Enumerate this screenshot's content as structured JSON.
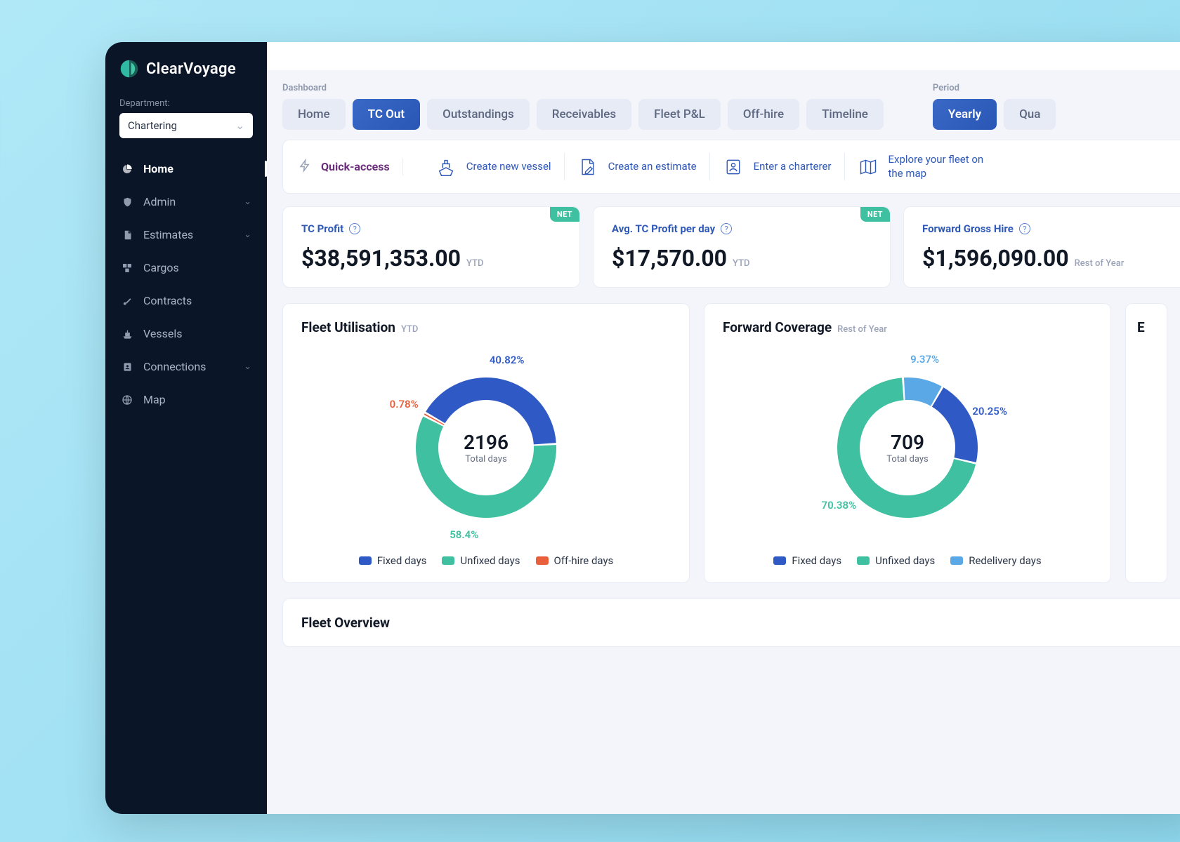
{
  "brand": {
    "name": "ClearVoyage"
  },
  "sidebar": {
    "department_label": "Department:",
    "department_value": "Chartering",
    "items": [
      {
        "label": "Home",
        "icon": "pie-chart-icon",
        "active": true,
        "hasChildren": false
      },
      {
        "label": "Admin",
        "icon": "shield-icon",
        "active": false,
        "hasChildren": true
      },
      {
        "label": "Estimates",
        "icon": "document-icon",
        "active": false,
        "hasChildren": true
      },
      {
        "label": "Cargos",
        "icon": "boxes-icon",
        "active": false,
        "hasChildren": false
      },
      {
        "label": "Contracts",
        "icon": "pin-icon",
        "active": false,
        "hasChildren": false
      },
      {
        "label": "Vessels",
        "icon": "ship-icon",
        "active": false,
        "hasChildren": false
      },
      {
        "label": "Connections",
        "icon": "contact-icon",
        "active": false,
        "hasChildren": true
      },
      {
        "label": "Map",
        "icon": "globe-icon",
        "active": false,
        "hasChildren": false
      }
    ]
  },
  "tabs": {
    "dashboard_label": "Dashboard",
    "dashboard": [
      {
        "label": "Home",
        "active": false
      },
      {
        "label": "TC Out",
        "active": true
      },
      {
        "label": "Outstandings",
        "active": false
      },
      {
        "label": "Receivables",
        "active": false
      },
      {
        "label": "Fleet P&L",
        "active": false
      },
      {
        "label": "Off-hire",
        "active": false
      },
      {
        "label": "Timeline",
        "active": false
      }
    ],
    "period_label": "Period",
    "period": [
      {
        "label": "Yearly",
        "active": true
      },
      {
        "label": "Qua",
        "active": false
      }
    ]
  },
  "quick_access": {
    "title": "Quick-access",
    "items": [
      {
        "label": "Create new vessel",
        "icon": "ship-outline-icon"
      },
      {
        "label": "Create an estimate",
        "icon": "doc-write-icon"
      },
      {
        "label": "Enter a charterer",
        "icon": "person-card-icon"
      },
      {
        "label": "Explore your fleet on the map",
        "icon": "map-icon"
      }
    ]
  },
  "kpis": [
    {
      "title": "TC Profit",
      "value": "$38,591,353.00",
      "caption": "YTD",
      "badge": "NET"
    },
    {
      "title": "Avg. TC Profit per day",
      "value": "$17,570.00",
      "caption": "YTD",
      "badge": "NET"
    },
    {
      "title": "Forward Gross Hire",
      "value": "$1,596,090.00",
      "caption": "Rest of Year",
      "badge": ""
    }
  ],
  "fleet_util": {
    "title": "Fleet Utilisation",
    "caption": "YTD",
    "center_value": "2196",
    "center_label": "Total days"
  },
  "fwd_cov": {
    "title": "Forward Coverage",
    "caption": "Rest of Year",
    "center_value": "709",
    "center_label": "Total days"
  },
  "peek_card": {
    "title_initial": "E"
  },
  "fleet_overview": {
    "title": "Fleet Overview"
  },
  "colors": {
    "fixed": "#2f59c4",
    "unfixed": "#3fc0a0",
    "offhire": "#e95f3c",
    "redelivery": "#5aa9e6"
  },
  "chart_data": [
    {
      "type": "pie",
      "title": "Fleet Utilisation YTD",
      "total_label": "Total days",
      "total_value": 2196,
      "series": [
        {
          "name": "Fixed days",
          "value_pct": 40.82,
          "color": "#2f59c4"
        },
        {
          "name": "Unfixed days",
          "value_pct": 58.4,
          "color": "#3fc0a0"
        },
        {
          "name": "Off-hire days",
          "value_pct": 0.78,
          "color": "#e95f3c"
        }
      ]
    },
    {
      "type": "pie",
      "title": "Forward Coverage Rest of Year",
      "total_label": "Total days",
      "total_value": 709,
      "series": [
        {
          "name": "Fixed days",
          "value_pct": 20.25,
          "color": "#2f59c4"
        },
        {
          "name": "Unfixed days",
          "value_pct": 70.38,
          "color": "#3fc0a0"
        },
        {
          "name": "Redelivery days",
          "value_pct": 9.37,
          "color": "#5aa9e6"
        }
      ]
    }
  ]
}
